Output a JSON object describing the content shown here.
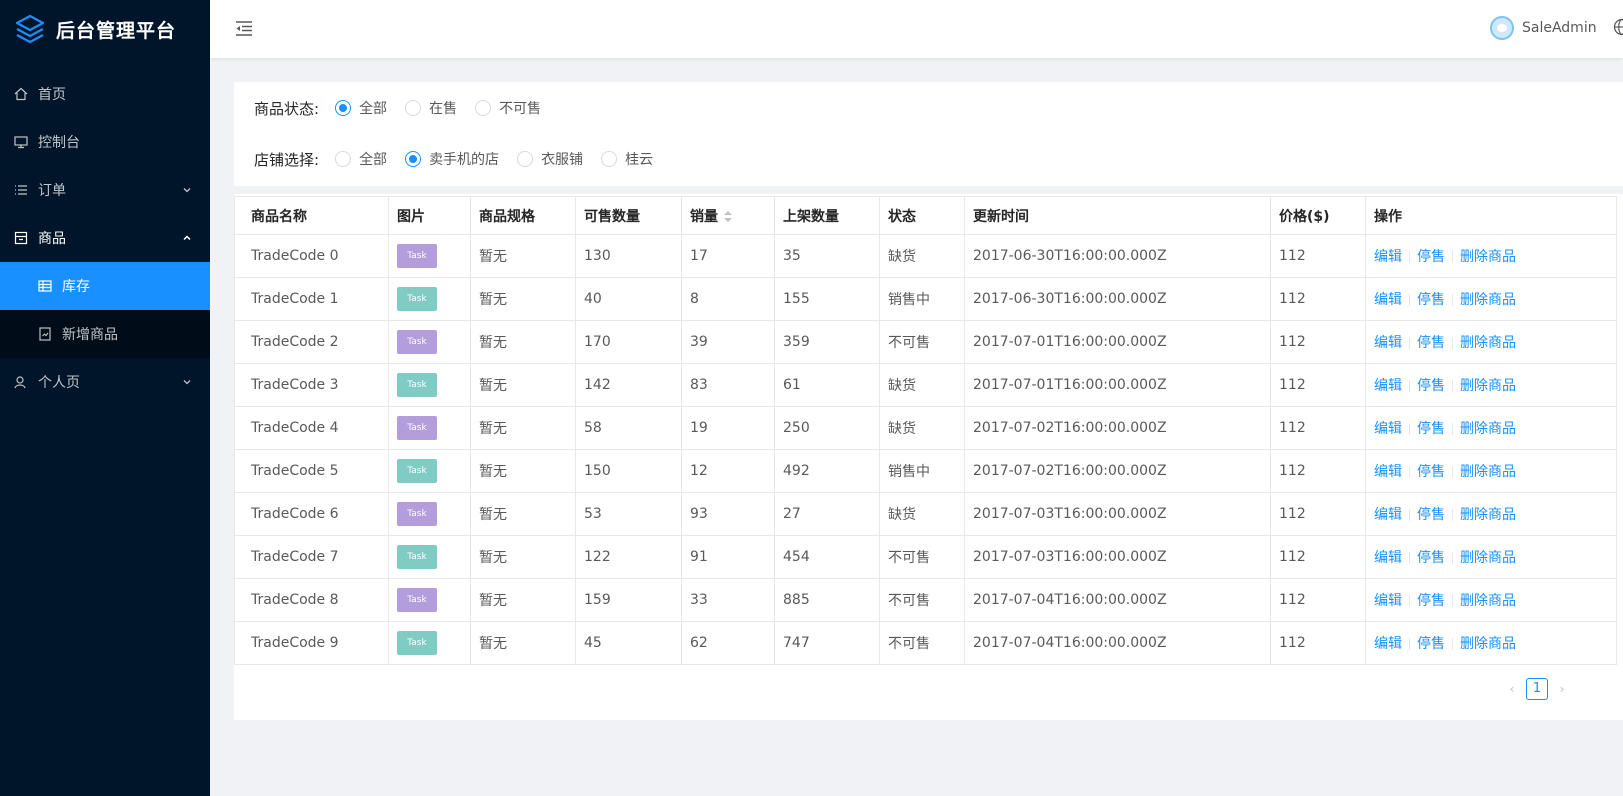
{
  "app": {
    "title": "后台管理平台"
  },
  "sidebar": {
    "items": [
      {
        "label": "首页",
        "icon": "home-icon"
      },
      {
        "label": "控制台",
        "icon": "desktop-icon"
      },
      {
        "label": "订单",
        "icon": "list-icon"
      },
      {
        "label": "商品",
        "icon": "shop-icon"
      },
      {
        "label": "个人页",
        "icon": "user-icon"
      }
    ],
    "goods_sub": [
      {
        "label": "库存",
        "icon": "table-icon",
        "active": true
      },
      {
        "label": "新增商品",
        "icon": "form-icon",
        "active": false
      }
    ]
  },
  "header": {
    "username": "SaleAdmin"
  },
  "filters": {
    "status": {
      "label": "商品状态:",
      "options": [
        "全部",
        "在售",
        "不可售"
      ],
      "selected": "全部"
    },
    "shop": {
      "label": "店铺选择:",
      "options": [
        "全部",
        "卖手机的店",
        "衣服铺",
        "桂云"
      ],
      "selected": "卖手机的店"
    }
  },
  "table": {
    "columns": [
      "商品名称",
      "图片",
      "商品规格",
      "可售数量",
      "销量",
      "上架数量",
      "状态",
      "更新时间",
      "价格($)",
      "操作"
    ],
    "image_label": "Task",
    "actions": [
      "编辑",
      "停售",
      "删除商品"
    ],
    "rows": [
      {
        "name": "TradeCode 0",
        "spec": "暂无",
        "available": "130",
        "sales": "17",
        "listed": "35",
        "status": "缺货",
        "updated": "2017-06-30T16:00:00.000Z",
        "price": "112",
        "img_color": "purple"
      },
      {
        "name": "TradeCode 1",
        "spec": "暂无",
        "available": "40",
        "sales": "8",
        "listed": "155",
        "status": "销售中",
        "updated": "2017-06-30T16:00:00.000Z",
        "price": "112",
        "img_color": "teal"
      },
      {
        "name": "TradeCode 2",
        "spec": "暂无",
        "available": "170",
        "sales": "39",
        "listed": "359",
        "status": "不可售",
        "updated": "2017-07-01T16:00:00.000Z",
        "price": "112",
        "img_color": "purple"
      },
      {
        "name": "TradeCode 3",
        "spec": "暂无",
        "available": "142",
        "sales": "83",
        "listed": "61",
        "status": "缺货",
        "updated": "2017-07-01T16:00:00.000Z",
        "price": "112",
        "img_color": "teal"
      },
      {
        "name": "TradeCode 4",
        "spec": "暂无",
        "available": "58",
        "sales": "19",
        "listed": "250",
        "status": "缺货",
        "updated": "2017-07-02T16:00:00.000Z",
        "price": "112",
        "img_color": "purple"
      },
      {
        "name": "TradeCode 5",
        "spec": "暂无",
        "available": "150",
        "sales": "12",
        "listed": "492",
        "status": "销售中",
        "updated": "2017-07-02T16:00:00.000Z",
        "price": "112",
        "img_color": "teal"
      },
      {
        "name": "TradeCode 6",
        "spec": "暂无",
        "available": "53",
        "sales": "93",
        "listed": "27",
        "status": "缺货",
        "updated": "2017-07-03T16:00:00.000Z",
        "price": "112",
        "img_color": "purple"
      },
      {
        "name": "TradeCode 7",
        "spec": "暂无",
        "available": "122",
        "sales": "91",
        "listed": "454",
        "status": "不可售",
        "updated": "2017-07-03T16:00:00.000Z",
        "price": "112",
        "img_color": "teal"
      },
      {
        "name": "TradeCode 8",
        "spec": "暂无",
        "available": "159",
        "sales": "33",
        "listed": "885",
        "status": "不可售",
        "updated": "2017-07-04T16:00:00.000Z",
        "price": "112",
        "img_color": "purple"
      },
      {
        "name": "TradeCode 9",
        "spec": "暂无",
        "available": "45",
        "sales": "62",
        "listed": "747",
        "status": "不可售",
        "updated": "2017-07-04T16:00:00.000Z",
        "price": "112",
        "img_color": "teal"
      }
    ]
  },
  "pagination": {
    "current": "1"
  },
  "colors": {
    "primary": "#1890ff",
    "sidebar_bg": "#001529",
    "submenu_bg": "#000c17"
  }
}
